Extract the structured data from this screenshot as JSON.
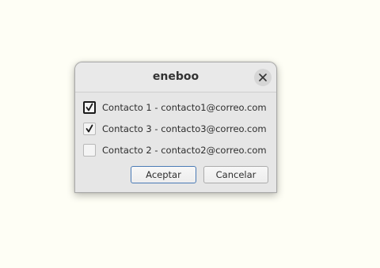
{
  "dialog": {
    "title": "eneboo",
    "close_icon": "close-icon",
    "contacts": [
      {
        "label": "Contacto 1 - contacto1@correo.com",
        "checked": true,
        "focused": true
      },
      {
        "label": "Contacto 3 - contacto3@correo.com",
        "checked": true,
        "focused": false
      },
      {
        "label": "Contacto 2 - contacto2@correo.com",
        "checked": false,
        "focused": false
      }
    ],
    "accept_label": "Aceptar",
    "cancel_label": "Cancelar"
  },
  "colors": {
    "desktop_background": "#fefef5",
    "dialog_background": "#e6e6e6",
    "default_button_border": "#4a7ab5"
  }
}
